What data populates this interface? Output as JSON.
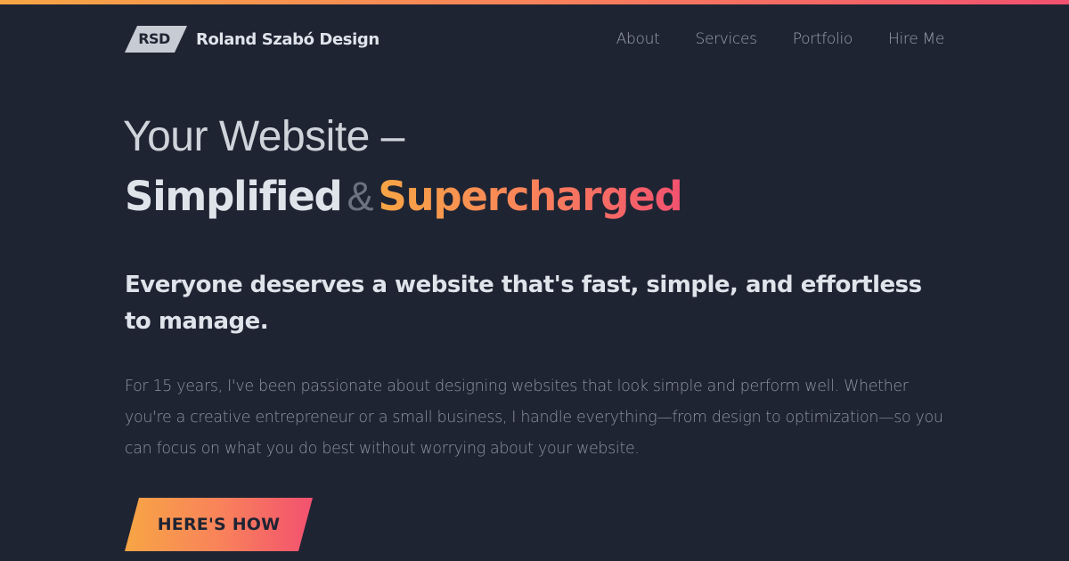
{
  "header": {
    "logo_text": "RSD",
    "brand_name": "Roland Szabó Design",
    "nav": [
      {
        "label": "About"
      },
      {
        "label": "Services"
      },
      {
        "label": "Portfolio"
      },
      {
        "label": "Hire Me"
      }
    ]
  },
  "hero": {
    "line1": "Your Website –",
    "simplified": "Simplified",
    "ampersand": "&",
    "supercharged": "Supercharged",
    "subheading": "Everyone deserves a website that's fast, simple, and effortless to manage.",
    "paragraph": "For 15 years, I've been passionate about designing websites that look simple and perform well. Whether you're a creative entrepreneur or a small business, I handle everything—from design to optimization—so you can focus on what you do best without worrying about your website.",
    "cta_label": "HERE'S HOW"
  },
  "colors": {
    "background": "#1f2433",
    "gradient_start": "#f7a545",
    "gradient_end": "#f2516f",
    "text_light": "#dfe3ea",
    "text_muted": "#8c93a0"
  }
}
